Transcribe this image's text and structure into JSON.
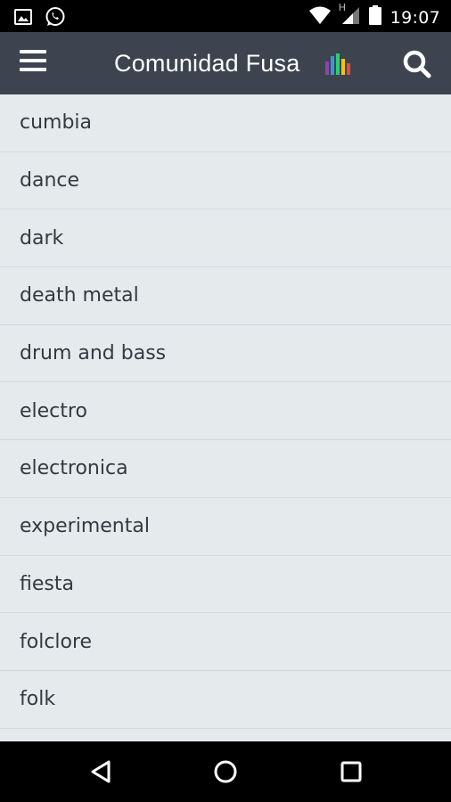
{
  "status_bar": {
    "time": "19:07",
    "network_letter": "H",
    "left_icons": [
      "image-icon",
      "whatsapp-icon"
    ],
    "right_icons": [
      "wifi-icon",
      "signal-icon",
      "battery-icon"
    ]
  },
  "app_bar": {
    "title": "Comunidad Fusa",
    "logo_colors": [
      "#8e44ad",
      "#3498db",
      "#2ecc71",
      "#f1c40f",
      "#e74c3c"
    ]
  },
  "genres": [
    {
      "label": "cumbia"
    },
    {
      "label": "dance"
    },
    {
      "label": "dark"
    },
    {
      "label": "death metal"
    },
    {
      "label": "drum and bass"
    },
    {
      "label": "electro"
    },
    {
      "label": "electronica"
    },
    {
      "label": "experimental"
    },
    {
      "label": "fiesta"
    },
    {
      "label": "folclore"
    },
    {
      "label": "folk"
    },
    {
      "label": ""
    }
  ],
  "colors": {
    "app_bar": "#3d4450",
    "list_bg": "#e5eaed",
    "list_text": "#333a40"
  }
}
